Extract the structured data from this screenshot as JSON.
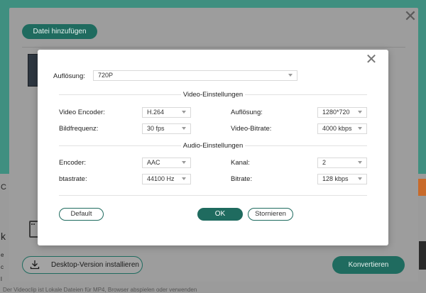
{
  "background": {
    "add_file_label": "Datei hinzufügen",
    "desktop_label": "Desktop-Version installieren",
    "convert_label": "Konvertieren",
    "left_fragments": [
      "C",
      "k",
      "e",
      "c",
      "l"
    ],
    "bottom_text": "Der Videoclip ist Lokale Dateien für MP4, Browser abspielen oder verwenden"
  },
  "dialog": {
    "resolution_label": "Auflösung:",
    "resolution_value": "720P",
    "video_section": "Video-Einstellungen",
    "video": {
      "encoder_label": "Video Encoder:",
      "encoder_value": "H.264",
      "resolution_label": "Auflösung:",
      "resolution_value": "1280*720",
      "framerate_label": "Bildfrequenz:",
      "framerate_value": "30 fps",
      "bitrate_label": "Video-Bitrate:",
      "bitrate_value": "4000 kbps"
    },
    "audio_section": "Audio-Einstellungen",
    "audio": {
      "encoder_label": "Encoder:",
      "encoder_value": "AAC",
      "channel_label": "Kanal:",
      "channel_value": "2",
      "samplerate_label": "btastrate:",
      "samplerate_value": "44100 Hz",
      "bitrate_label": "Bitrate:",
      "bitrate_value": "128 kbps"
    },
    "default_label": "Default",
    "ok_label": "OK",
    "cancel_label": "Stornieren"
  },
  "colors": {
    "accent": "#1f6b5f",
    "overlay": "#9d9d9d",
    "dialog_bg": "#ffffff"
  },
  "icons": [
    "close-icon",
    "dropdown-caret-icon",
    "download-icon",
    "film-icon"
  ]
}
